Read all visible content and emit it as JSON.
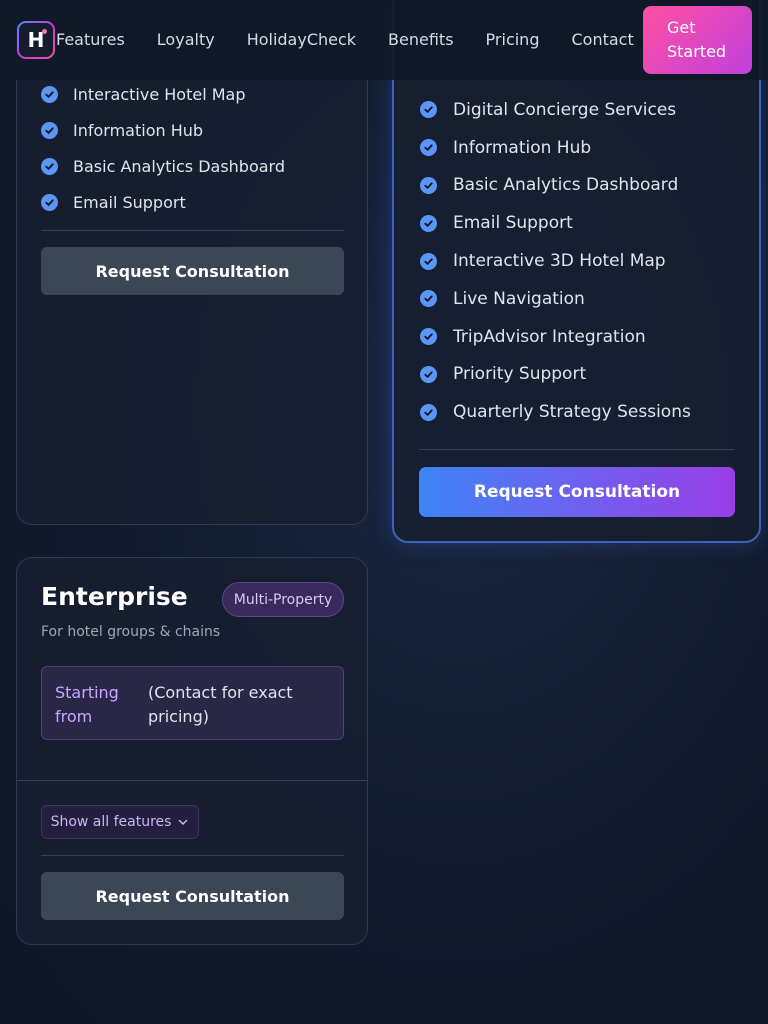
{
  "header": {
    "logo_letter": "H",
    "nav": [
      {
        "label": "Features"
      },
      {
        "label": "Loyalty"
      },
      {
        "label": "HolidayCheck"
      },
      {
        "label": "Benefits"
      },
      {
        "label": "Pricing"
      },
      {
        "label": "Contact"
      }
    ],
    "cta_label": "Get Started"
  },
  "plans": {
    "left": {
      "features": [
        "Interactive Hotel Map",
        "Information Hub",
        "Basic Analytics Dashboard",
        "Email Support"
      ],
      "button_label": "Request Consultation"
    },
    "featured": {
      "features": [
        "Digital Concierge Services",
        "Information Hub",
        "Basic Analytics Dashboard",
        "Email Support",
        "Interactive 3D Hotel Map",
        "Live Navigation",
        "TripAdvisor Integration",
        "Priority Support",
        "Quarterly Strategy Sessions"
      ],
      "button_label": "Request Consultation"
    },
    "enterprise": {
      "title": "Enterprise",
      "badge": "Multi-Property",
      "subtitle": "For hotel groups & chains",
      "price_label": "Starting from",
      "price_value": "(Contact for exact pricing)",
      "show_all_label": "Show all features",
      "button_label": "Request Consultation"
    }
  },
  "icons": {
    "check": "check-circle-icon",
    "chevron": "chevron-down-icon"
  },
  "colors": {
    "accent_blue": "#5b96f5",
    "cta_pink": "#ff4fa0",
    "cta_purple": "#c040e0",
    "featured_border": "#3b63b8"
  }
}
